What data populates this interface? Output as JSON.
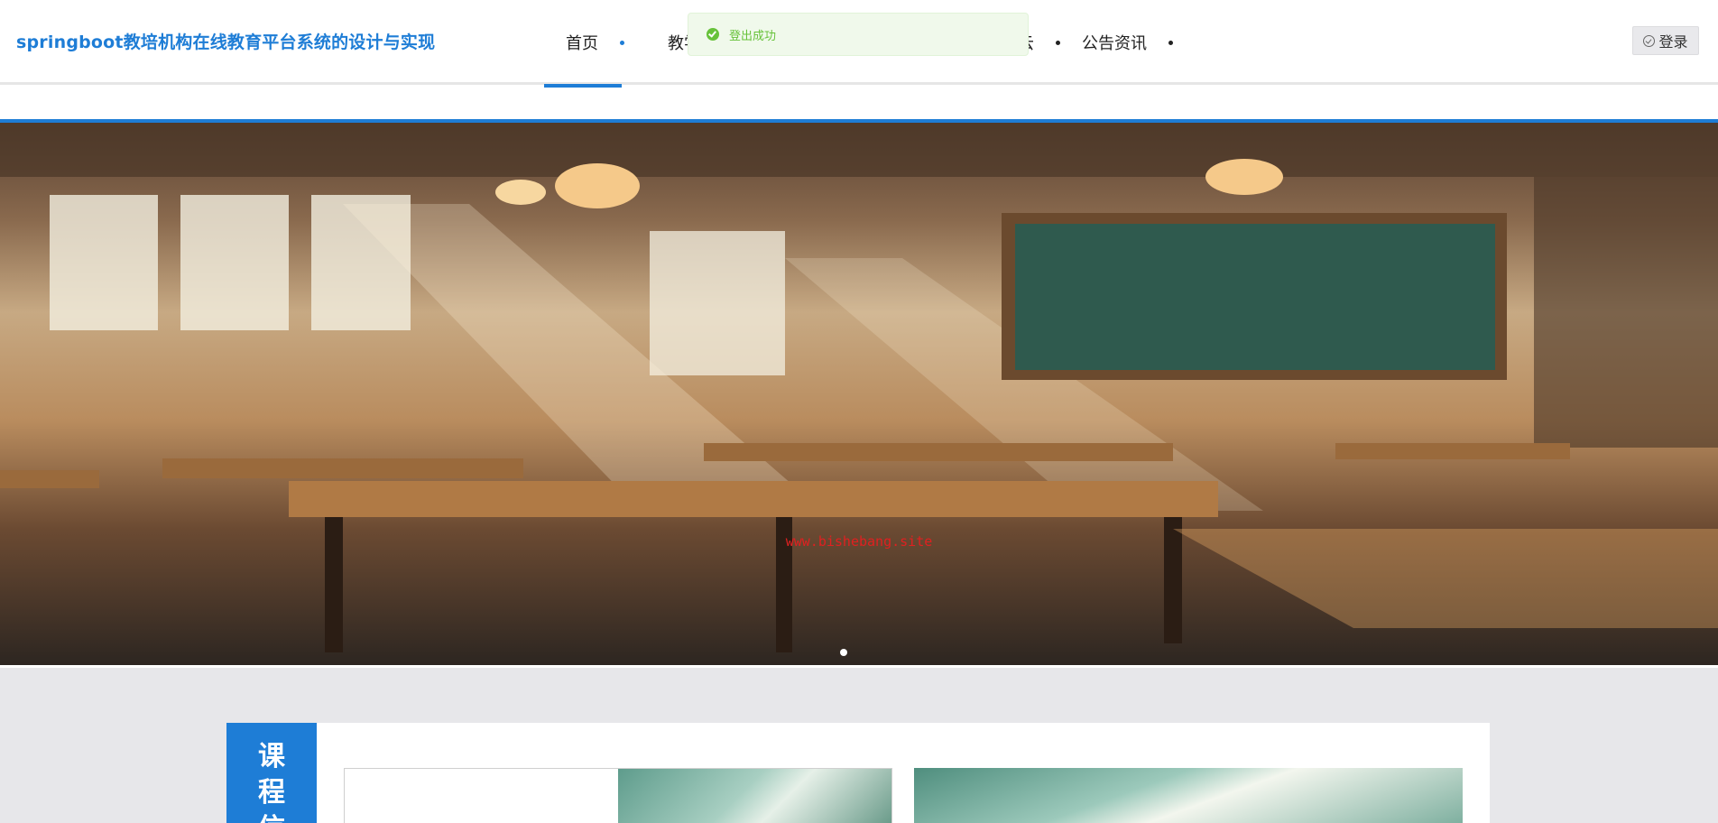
{
  "header": {
    "site_title": "springboot教培机构在线教育平台系统的设计与实现",
    "nav": [
      {
        "label": "首页",
        "active": true
      },
      {
        "label": "教学资",
        "active": false
      },
      {
        "label": "云",
        "active": false
      },
      {
        "label": "公告资讯",
        "active": false
      }
    ],
    "login_label": "登录"
  },
  "toast": {
    "message": "登出成功",
    "type": "success"
  },
  "banner": {
    "watermark": "www.bishebang.site",
    "slide_count": 1,
    "active_slide": 1
  },
  "course_section": {
    "title_chars": [
      "课",
      "程",
      "信"
    ]
  },
  "colors": {
    "accent": "#1e7dd6",
    "success": "#67c23a",
    "watermark": "#e02020"
  }
}
